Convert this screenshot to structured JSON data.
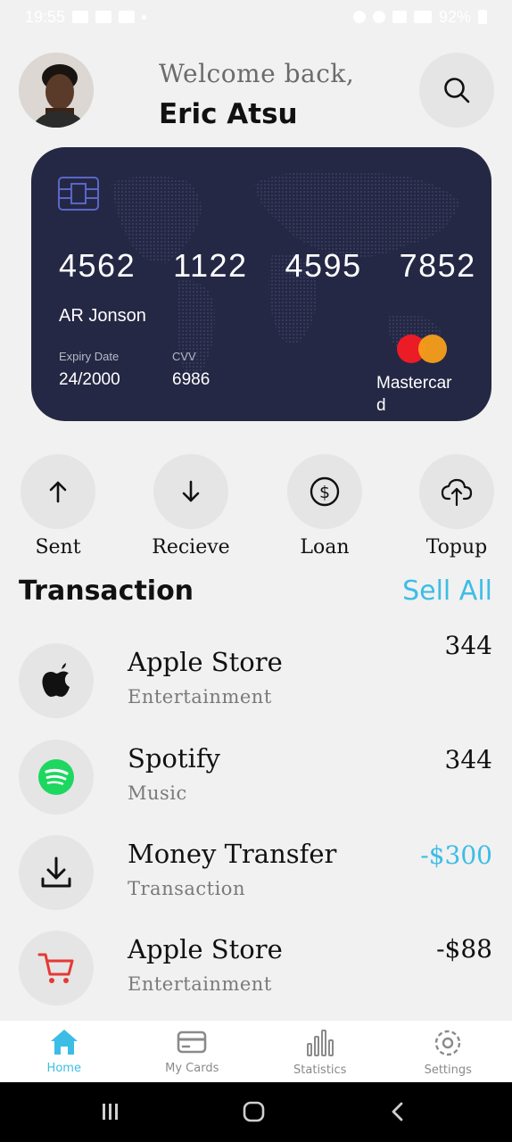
{
  "status_bar": {
    "time": "19:55",
    "battery": "92%"
  },
  "header": {
    "welcome": "Welcome back,",
    "username": "Eric Atsu"
  },
  "card": {
    "number_groups": [
      "4562",
      "1122",
      "4595",
      "7852"
    ],
    "holder": "AR Jonson",
    "expiry_label": "Expiry Date",
    "expiry": "24/2000",
    "cvv_label": "CVV",
    "cvv": "6986",
    "brand": "Mastercard",
    "background_color": "#252844"
  },
  "actions": [
    {
      "label": "Sent",
      "icon": "arrow-up-icon"
    },
    {
      "label": "Recieve",
      "icon": "arrow-down-icon"
    },
    {
      "label": "Loan",
      "icon": "dollar-circle-icon"
    },
    {
      "label": "Topup",
      "icon": "cloud-upload-icon"
    }
  ],
  "transactions_section": {
    "title": "Transaction",
    "see_all": "Sell All"
  },
  "transactions": [
    {
      "title": "Apple Store",
      "subtitle": "Entertainment",
      "amount": "344",
      "icon": "apple-icon"
    },
    {
      "title": "Spotify",
      "subtitle": "Music",
      "amount": "344",
      "icon": "spotify-icon"
    },
    {
      "title": "Money Transfer",
      "subtitle": "Transaction",
      "amount": "-$300",
      "icon": "download-icon"
    },
    {
      "title": "Apple Store",
      "subtitle": "Entertainment",
      "amount": "-$88",
      "icon": "cart-icon"
    }
  ],
  "bottom_nav": [
    {
      "label": "Home",
      "icon": "home-icon",
      "active": true
    },
    {
      "label": "My Cards",
      "icon": "card-icon",
      "active": false
    },
    {
      "label": "Statistics",
      "icon": "bar-chart-icon",
      "active": false
    },
    {
      "label": "Settings",
      "icon": "gear-icon",
      "active": false
    }
  ],
  "colors": {
    "accent": "#3cbde6",
    "background": "#f1f1f1",
    "circle": "#e5e5e5"
  }
}
